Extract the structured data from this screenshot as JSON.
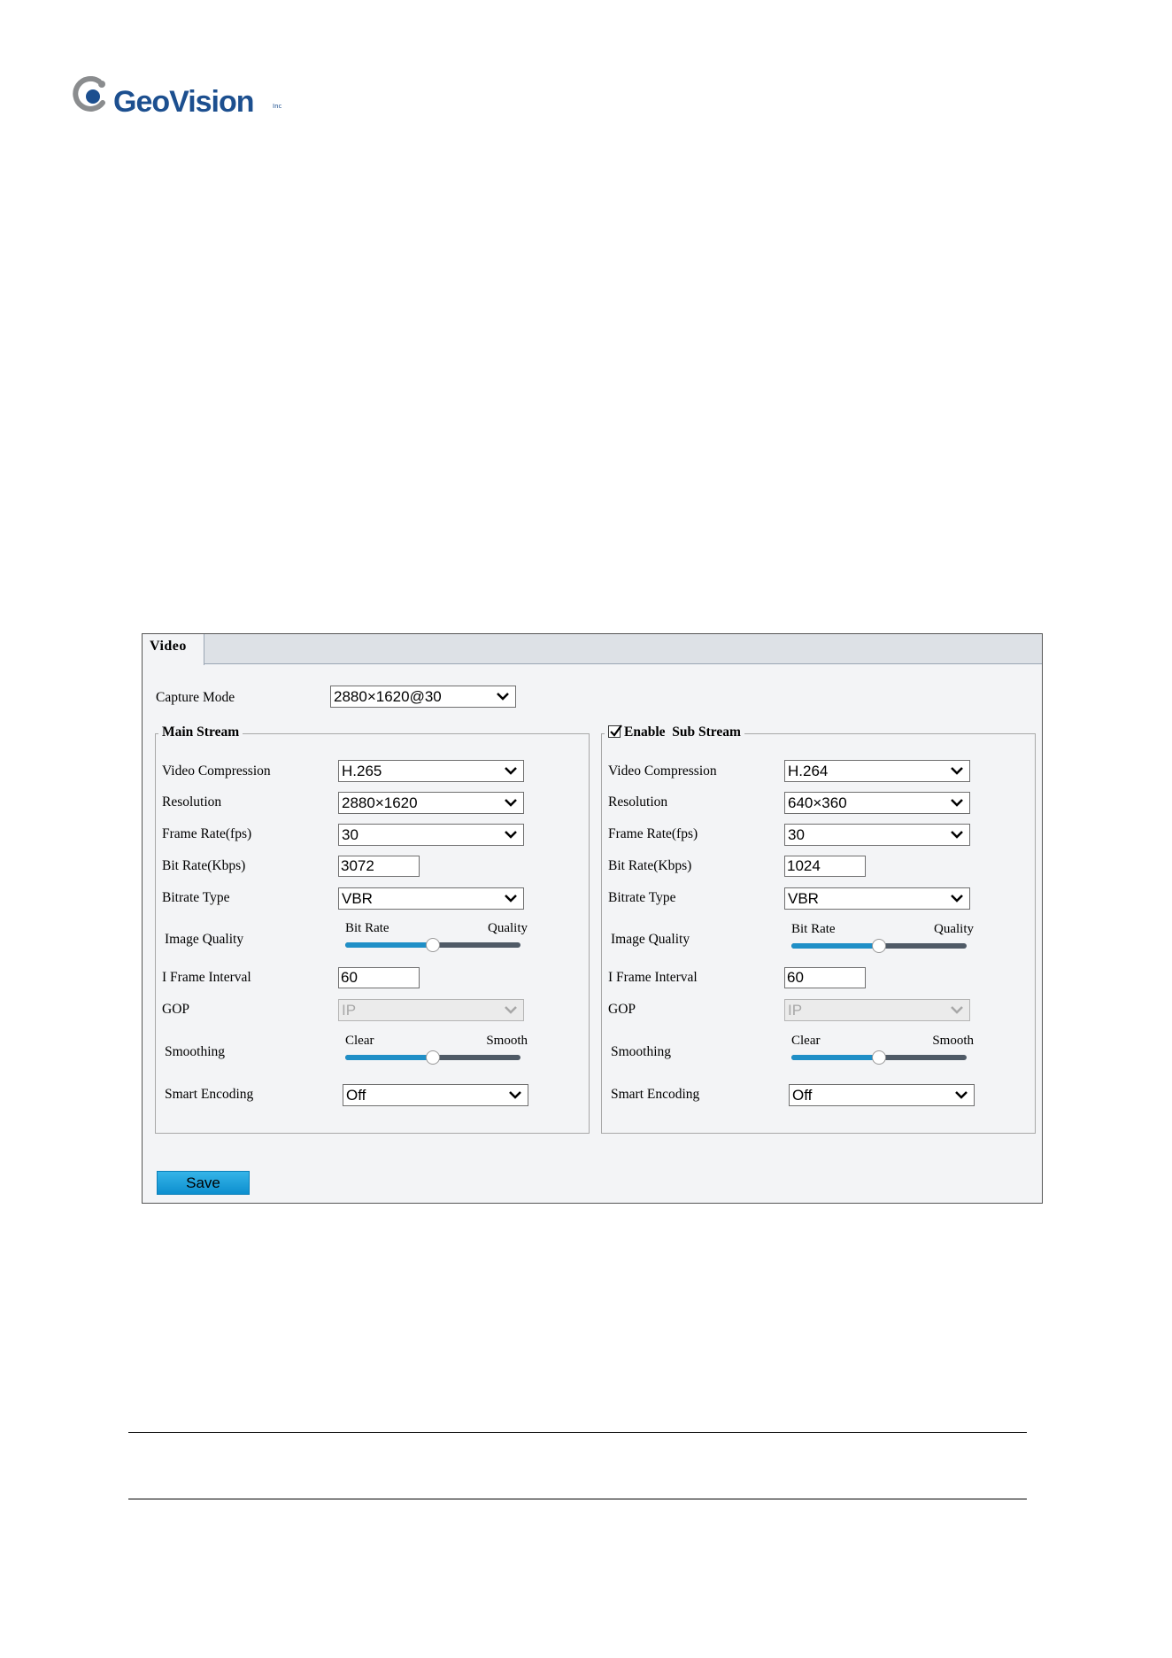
{
  "logo": {
    "text": "GeoVision",
    "tm": "Inc"
  },
  "tab": {
    "title": "Video"
  },
  "capture_mode": {
    "label": "Capture Mode",
    "value": "2880×1620@30"
  },
  "main_stream": {
    "title": "Main Stream",
    "video_compression": {
      "label": "Video Compression",
      "value": "H.265"
    },
    "resolution": {
      "label": "Resolution",
      "value": "2880×1620"
    },
    "frame_rate": {
      "label": "Frame Rate(fps)",
      "value": "30"
    },
    "bit_rate": {
      "label": "Bit Rate(Kbps)",
      "value": "3072"
    },
    "bitrate_type": {
      "label": "Bitrate Type",
      "value": "VBR"
    },
    "image_quality": {
      "label": "Image Quality",
      "left": "Bit Rate",
      "right": "Quality",
      "level": 0.5
    },
    "i_frame_interval": {
      "label": "I Frame Interval",
      "value": "60"
    },
    "gop": {
      "label": "GOP",
      "value": "IP"
    },
    "smoothing": {
      "label": "Smoothing",
      "left": "Clear",
      "right": "Smooth",
      "level": 0.5
    },
    "smart_encoding": {
      "label": "Smart Encoding",
      "value": "Off"
    }
  },
  "sub_stream": {
    "title": "Enable  Sub Stream",
    "enabled": true,
    "video_compression": {
      "label": "Video Compression",
      "value": "H.264"
    },
    "resolution": {
      "label": "Resolution",
      "value": "640×360"
    },
    "frame_rate": {
      "label": "Frame Rate(fps)",
      "value": "30"
    },
    "bit_rate": {
      "label": "Bit Rate(Kbps)",
      "value": "1024"
    },
    "bitrate_type": {
      "label": "Bitrate Type",
      "value": "VBR"
    },
    "image_quality": {
      "label": "Image Quality",
      "left": "Bit Rate",
      "right": "Quality",
      "level": 0.5
    },
    "i_frame_interval": {
      "label": "I Frame Interval",
      "value": "60"
    },
    "gop": {
      "label": "GOP",
      "value": "IP"
    },
    "smoothing": {
      "label": "Smoothing",
      "left": "Clear",
      "right": "Smooth",
      "level": 0.5
    },
    "smart_encoding": {
      "label": "Smart Encoding",
      "value": "Off"
    }
  },
  "save_button": "Save",
  "colors": {
    "brand": "#1c4f8f",
    "logo_gray": "#8a8c8e",
    "button": "#1a9ad8",
    "slider_fill": "#1f8fc7"
  },
  "icons": {
    "dropdown": "chevron-down-icon",
    "checkbox": "checkmark-icon"
  }
}
